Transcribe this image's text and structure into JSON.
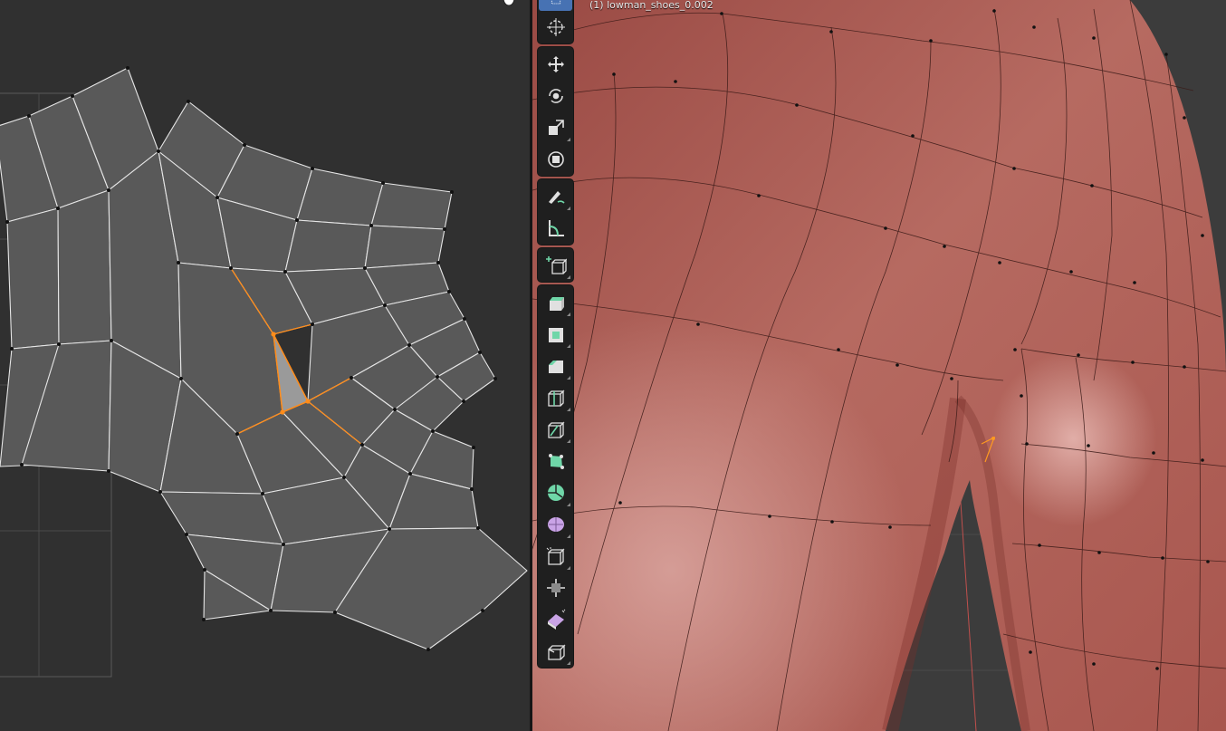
{
  "viewport": {
    "object_label": "(1) lowman_shoes_0.002"
  },
  "toolbar": {
    "groups": [
      [
        "select-box-icon",
        "cursor-icon"
      ],
      [
        "move-icon",
        "rotate-icon",
        "scale-icon",
        "transform-icon"
      ],
      [
        "annotate-icon",
        "measure-icon"
      ],
      [
        "add-cube-icon"
      ],
      [
        "extrude-region-icon",
        "inset-faces-icon",
        "bevel-icon",
        "loop-cut-icon",
        "knife-icon",
        "poly-build-icon",
        "spin-icon",
        "smooth-icon",
        "edge-slide-icon",
        "shrink-fatten-icon",
        "shear-icon",
        "rip-region-icon"
      ]
    ]
  },
  "colors": {
    "uv_background": "#303030",
    "uv_face": "#555555",
    "uv_edge": "#e8e8e8",
    "selection": "#ff8c1a",
    "mesh_skin": "#b4645a",
    "active_tool": "#4772b3"
  }
}
